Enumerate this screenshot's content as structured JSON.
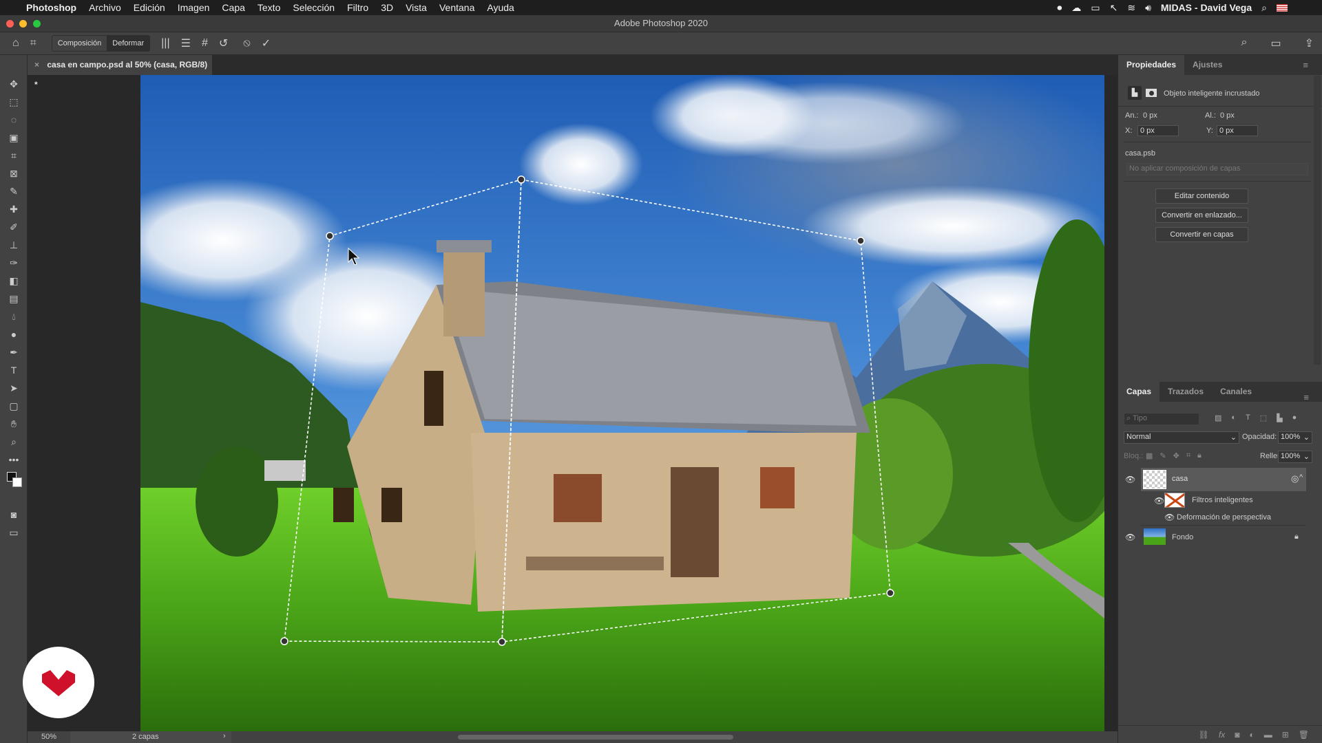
{
  "menubar": {
    "app": "Photoshop",
    "items": [
      "Archivo",
      "Edición",
      "Imagen",
      "Capa",
      "Texto",
      "Selección",
      "Filtro",
      "3D",
      "Vista",
      "Ventana",
      "Ayuda"
    ],
    "user": "MIDAS - David Vega"
  },
  "window": {
    "title": "Adobe Photoshop 2020"
  },
  "options": {
    "composicion": "Composición",
    "deformar": "Deformar"
  },
  "document": {
    "tab": "casa en campo.psd al 50% (casa, RGB/8) *"
  },
  "status": {
    "zoom": "50%",
    "info": "2 capas"
  },
  "properties": {
    "tabs": [
      "Propiedades",
      "Ajustes"
    ],
    "type": "Objeto inteligente incrustado",
    "an_label": "An.:",
    "an": "0 px",
    "al_label": "Al.:",
    "al": "0 px",
    "x_label": "X:",
    "x": "0 px",
    "y_label": "Y:",
    "y": "0 px",
    "file": "casa.psb",
    "comp_placeholder": "No aplicar composición de capas",
    "buttons": [
      "Editar contenido",
      "Convertir en enlazado...",
      "Convertir en capas"
    ]
  },
  "layers": {
    "tabs": [
      "Capas",
      "Trazados",
      "Canales"
    ],
    "filter_placeholder": "Tipo",
    "blend": "Normal",
    "opacity_label": "Opacidad:",
    "opacity": "100%",
    "lock_label": "Bloq.:",
    "fill_label": "Relleno:",
    "fill": "100%",
    "items": [
      {
        "name": "casa",
        "selected": true
      },
      {
        "name": "Filtros inteligentes"
      },
      {
        "name": "Deformación de perspectiva"
      },
      {
        "name": "Fondo",
        "locked": true
      }
    ]
  },
  "colors": {
    "accent": "#2f7de1",
    "panel": "#424242",
    "sky": "#2f6fc4",
    "grass": "#58b81c"
  }
}
